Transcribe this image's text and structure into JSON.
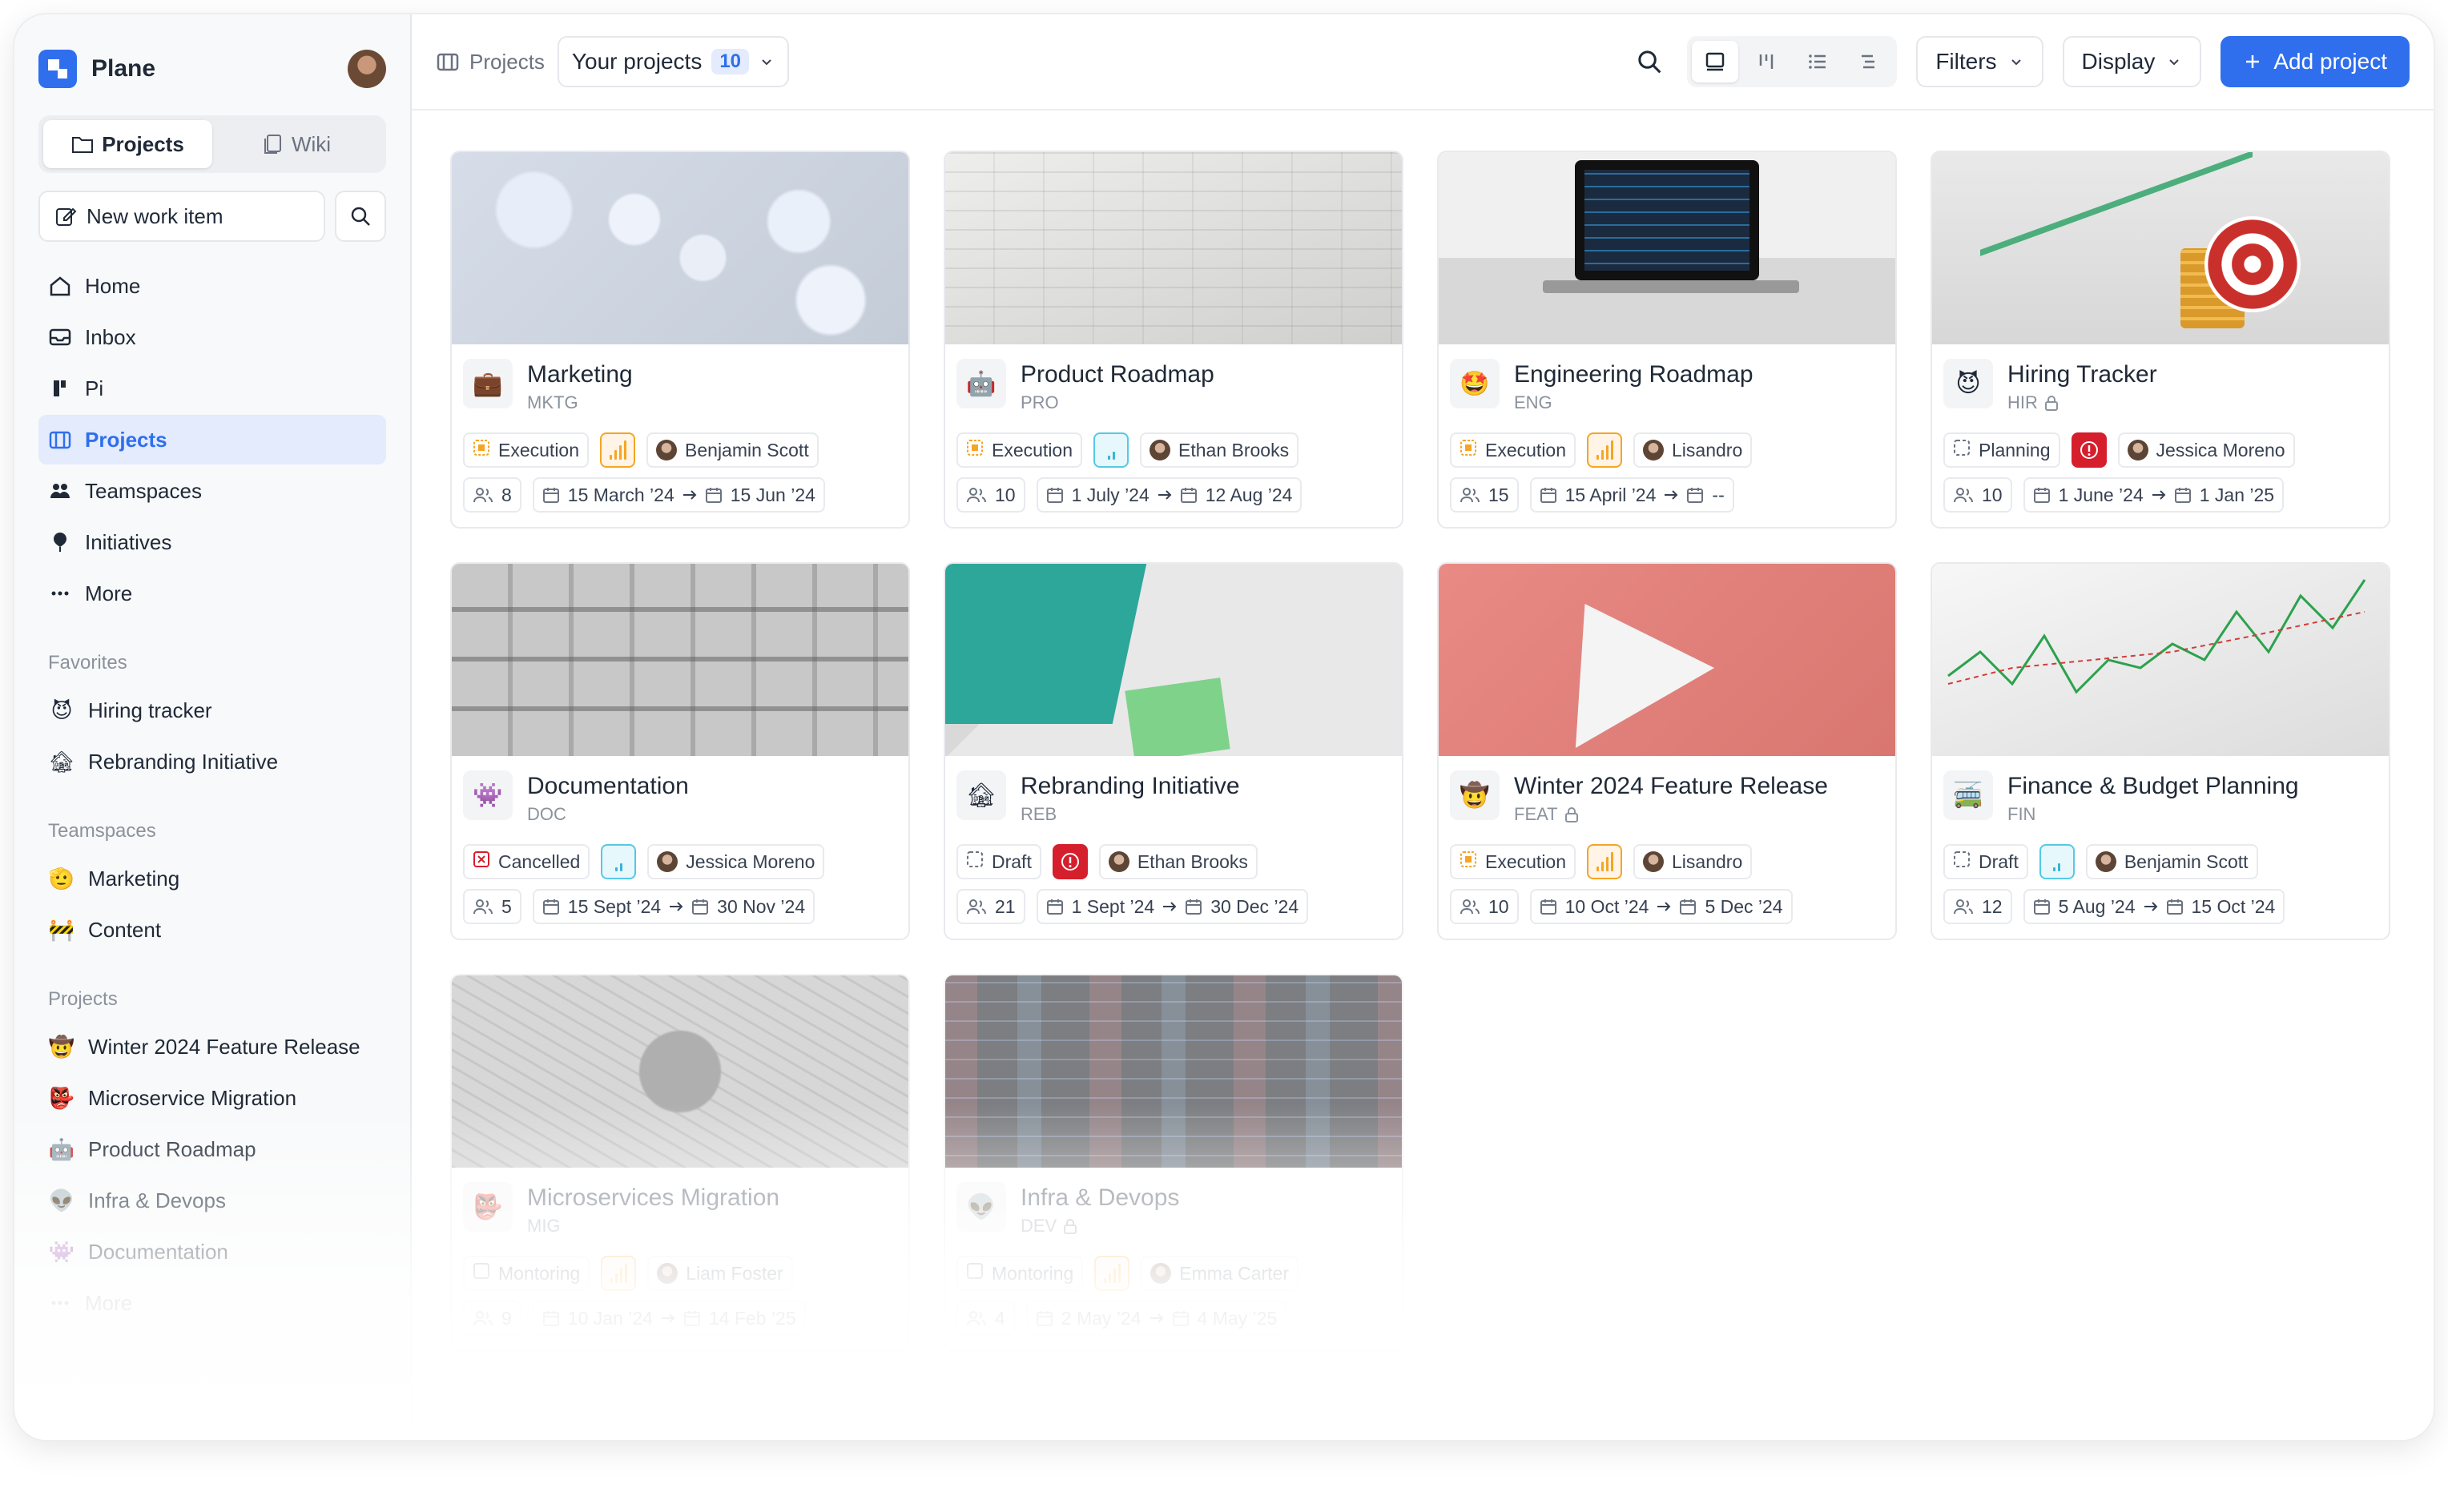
{
  "workspace": {
    "name": "Plane"
  },
  "sidebar": {
    "tabs": [
      {
        "label": "Projects"
      },
      {
        "label": "Wiki"
      }
    ],
    "new_work_item": "New work item",
    "nav": [
      {
        "label": "Home",
        "icon": "home-icon"
      },
      {
        "label": "Inbox",
        "icon": "inbox-icon"
      },
      {
        "label": "Pi",
        "icon": "pi-icon"
      },
      {
        "label": "Projects",
        "icon": "projects-icon"
      },
      {
        "label": "Teamspaces",
        "icon": "teamspaces-icon"
      },
      {
        "label": "Initiatives",
        "icon": "initiatives-icon"
      },
      {
        "label": "More",
        "icon": "more-icon"
      }
    ],
    "favorites": {
      "title": "Favorites",
      "items": [
        {
          "label": "Hiring tracker",
          "emoji": "😈"
        },
        {
          "label": "Rebranding Initiative",
          "emoji": "🏚"
        }
      ]
    },
    "teamspaces": {
      "title": "Teamspaces",
      "items": [
        {
          "label": "Marketing",
          "emoji": "🫡"
        },
        {
          "label": "Content",
          "emoji": "🚧"
        }
      ]
    },
    "projects": {
      "title": "Projects",
      "items": [
        {
          "label": "Winter 2024 Feature Release",
          "emoji": "🤠"
        },
        {
          "label": "Microservice Migration",
          "emoji": "👺"
        },
        {
          "label": "Product Roadmap",
          "emoji": "🤖"
        },
        {
          "label": "Infra & Devops",
          "emoji": "👽"
        },
        {
          "label": "Documentation",
          "emoji": "👾"
        }
      ],
      "more": "More"
    }
  },
  "header": {
    "breadcrumb": "Projects",
    "selector_label": "Your projects",
    "selector_count": "10",
    "filters_label": "Filters",
    "display_label": "Display",
    "add_label": "Add project"
  },
  "projects": [
    {
      "name": "Marketing",
      "id": "MKTG",
      "emoji": "💼",
      "state": "Execution",
      "priority": "high",
      "lead": "Benjamin Scott",
      "members": "8",
      "start": "15 March ’24",
      "end": "15 Jun ’24",
      "locked": false,
      "cover": "cv-mkt"
    },
    {
      "name": "Product Roadmap",
      "id": "PRO",
      "emoji": "🤖",
      "state": "Execution",
      "priority": "low",
      "lead": "Ethan Brooks",
      "members": "10",
      "start": "1 July ’24",
      "end": "12 Aug ’24",
      "locked": false,
      "cover": "cv-pro"
    },
    {
      "name": "Engineering Roadmap",
      "id": "ENG",
      "emoji": "🤩",
      "state": "Execution",
      "priority": "high",
      "lead": "Lisandro",
      "members": "15",
      "start": "15 April ’24",
      "end": "--",
      "locked": false,
      "cover": "cv-eng"
    },
    {
      "name": "Hiring Tracker",
      "id": "HIR",
      "emoji": "😈",
      "state": "Planning",
      "priority": "urgent",
      "lead": "Jessica Moreno",
      "members": "10",
      "start": "1 June ’24",
      "end": "1 Jan ’25",
      "locked": true,
      "cover": "cv-hir"
    },
    {
      "name": "Documentation",
      "id": "DOC",
      "emoji": "👾",
      "state": "Cancelled",
      "priority": "low",
      "lead": "Jessica Moreno",
      "members": "5",
      "start": "15 Sept ’24",
      "end": "30 Nov ’24",
      "locked": false,
      "cover": "cv-doc"
    },
    {
      "name": "Rebranding Initiative",
      "id": "REB",
      "emoji": "🏚",
      "state": "Draft",
      "priority": "urgent",
      "lead": "Ethan Brooks",
      "members": "21",
      "start": "1 Sept ’24",
      "end": "30 Dec ’24",
      "locked": false,
      "cover": "cv-reb"
    },
    {
      "name": "Winter 2024 Feature Release",
      "id": "FEAT",
      "emoji": "🤠",
      "state": "Execution",
      "priority": "high",
      "lead": "Lisandro",
      "members": "10",
      "start": "10 Oct ’24",
      "end": "5 Dec ’24",
      "locked": true,
      "cover": "cv-feat"
    },
    {
      "name": "Finance & Budget Planning",
      "id": "FIN",
      "emoji": "🚎",
      "state": "Draft",
      "priority": "low",
      "lead": "Benjamin Scott",
      "members": "12",
      "start": "5 Aug ’24",
      "end": "15 Oct ’24",
      "locked": false,
      "cover": "cv-fin"
    },
    {
      "name": "Microservices Migration",
      "id": "MIG",
      "emoji": "👺",
      "state": "Montoring",
      "priority": "high",
      "lead": "Liam Foster",
      "members": "9",
      "start": "10 Jan ’24",
      "end": "14 Feb ’25",
      "locked": false,
      "cover": "cv-mig"
    },
    {
      "name": "Infra & Devops",
      "id": "DEV",
      "emoji": "👽",
      "state": "Montoring",
      "priority": "high",
      "lead": "Emma Carter",
      "members": "4",
      "start": "2 May ’24",
      "end": "4 May ’25",
      "locked": true,
      "cover": "cv-dev"
    }
  ],
  "colors": {
    "accent": "#2f6fed",
    "urgent": "#d61f2c",
    "high": "#f5a524",
    "low": "#3ab3d6",
    "state_execution": "#f5a524",
    "state_cancelled": "#d61f2c"
  }
}
